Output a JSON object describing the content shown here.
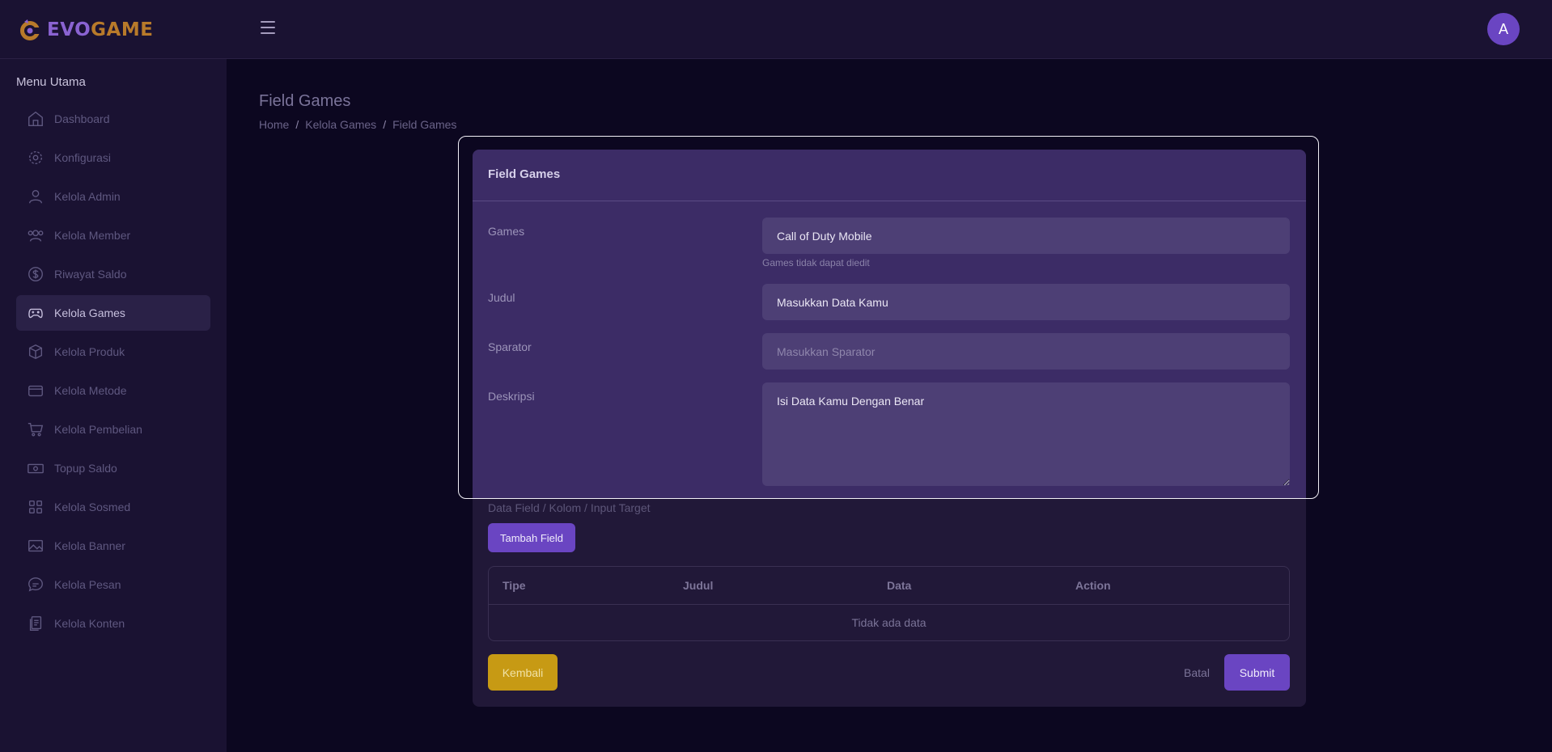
{
  "app": {
    "brand_left": "EVO",
    "brand_right": "GAME",
    "avatar_initial": "A"
  },
  "colors": {
    "accent": "#6a45c2",
    "warning": "#c79a14",
    "sidebar_bg": "#1a1232",
    "page_bg": "#0c0720"
  },
  "sidebar": {
    "title": "Menu Utama",
    "items": [
      {
        "label": "Dashboard",
        "icon": "home-icon"
      },
      {
        "label": "Konfigurasi",
        "icon": "gear-icon"
      },
      {
        "label": "Kelola Admin",
        "icon": "user-icon"
      },
      {
        "label": "Kelola Member",
        "icon": "users-icon"
      },
      {
        "label": "Riwayat Saldo",
        "icon": "dollar-icon"
      },
      {
        "label": "Kelola Games",
        "icon": "gamepad-icon",
        "active": true
      },
      {
        "label": "Kelola Produk",
        "icon": "box-icon"
      },
      {
        "label": "Kelola Metode",
        "icon": "card-icon"
      },
      {
        "label": "Kelola Pembelian",
        "icon": "cart-icon"
      },
      {
        "label": "Topup Saldo",
        "icon": "money-icon"
      },
      {
        "label": "Kelola Sosmed",
        "icon": "grid-icon"
      },
      {
        "label": "Kelola Banner",
        "icon": "image-icon"
      },
      {
        "label": "Kelola Pesan",
        "icon": "chat-icon"
      },
      {
        "label": "Kelola Konten",
        "icon": "document-icon"
      }
    ]
  },
  "page": {
    "title": "Field Games",
    "breadcrumb": [
      "Home",
      "Kelola Games",
      "Field Games"
    ]
  },
  "form": {
    "card_title": "Field Games",
    "games": {
      "label": "Games",
      "value": "Call of Duty Mobile",
      "hint": "Games tidak dapat diedit"
    },
    "judul": {
      "label": "Judul",
      "value": "Masukkan Data Kamu"
    },
    "sparator": {
      "label": "Sparator",
      "placeholder": "Masukkan Sparator"
    },
    "deskripsi": {
      "label": "Deskripsi",
      "value": "Isi Data Kamu Dengan Benar"
    },
    "fields_section_label": "Data Field / Kolom / Input Target",
    "add_field_label": "Tambah Field",
    "table": {
      "columns": [
        "Tipe",
        "Judul",
        "Data",
        "Action"
      ],
      "empty_text": "Tidak ada data"
    },
    "back_label": "Kembali",
    "cancel_label": "Batal",
    "submit_label": "Submit"
  }
}
